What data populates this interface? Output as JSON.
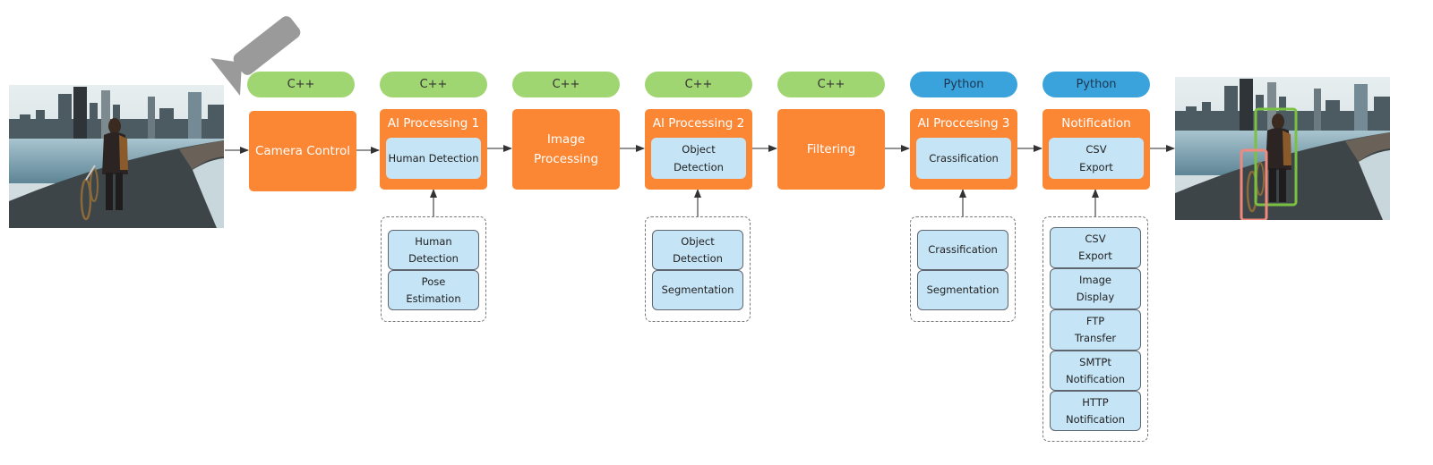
{
  "diagram": {
    "input_image": {
      "description": "city-skyline-person-with-bicycle"
    },
    "output_image": {
      "description": "city-skyline-person-with-bicycle-annotated",
      "detections": [
        {
          "label": "person",
          "color": "#7ac143"
        },
        {
          "label": "bicycle",
          "color": "#f08a7e"
        }
      ]
    },
    "camera_icon": "camera-icon",
    "colors": {
      "stage": "#fb8735",
      "cpp_pill": "#9fd672",
      "python_pill": "#3ba3dc",
      "sub_box": "#c5e4f6"
    },
    "stages": [
      {
        "language": "C++",
        "title": "Camera Control",
        "inner": null
      },
      {
        "language": "C++",
        "title": "AI Processing 1",
        "inner": "Human Detection",
        "options": [
          "Human Detection",
          "Pose\nEstimation"
        ]
      },
      {
        "language": "C++",
        "title": "Image\nProcessing",
        "inner": null
      },
      {
        "language": "C++",
        "title": "AI Processing 2",
        "inner": "Object\nDetection",
        "options": [
          "Object\nDetection",
          "Segmentation"
        ]
      },
      {
        "language": "C++",
        "title": "Filtering",
        "inner": null
      },
      {
        "language": "Python",
        "title": "AI Proccesing 3",
        "inner": "Crassification",
        "options": [
          "Crassification",
          "Segmentation"
        ]
      },
      {
        "language": "Python",
        "title": "Notification",
        "inner": "CSV\nExport",
        "options": [
          "CSV\nExport",
          "Image\nDisplay",
          "FTP\nTransfer",
          "SMTPt\nNotification",
          "HTTP\nNotification"
        ]
      }
    ]
  }
}
